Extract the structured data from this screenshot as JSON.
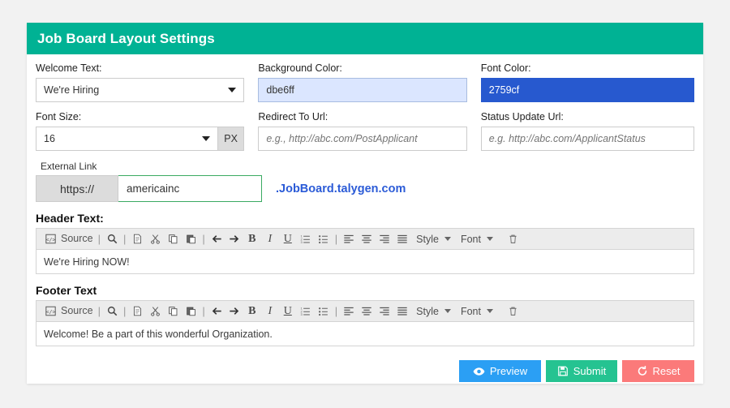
{
  "header": {
    "title": "Job Board Layout Settings",
    "bg_color": "#00b294"
  },
  "form": {
    "welcome_text": {
      "label": "Welcome Text:",
      "value": "We're Hiring"
    },
    "background_color": {
      "label": "Background Color:",
      "value": "dbe6ff",
      "swatch": "#dbe6ff"
    },
    "font_color": {
      "label": "Font Color:",
      "value": "2759cf",
      "swatch": "#2759cf"
    },
    "font_size": {
      "label": "Font Size:",
      "value": "16",
      "unit": "PX"
    },
    "redirect_url": {
      "label": "Redirect To Url:",
      "placeholder": "e.g., http://abc.com/PostApplicant",
      "value": ""
    },
    "status_update_url": {
      "label": "Status Update Url:",
      "placeholder": "e.g. http://abc.com/ApplicantStatus",
      "value": ""
    },
    "external_link": {
      "label": "External Link",
      "prefix": "https://",
      "value": "americainc",
      "suffix": ".JobBoard.talygen.com",
      "suffix_color": "#2b5bd7",
      "input_border_color": "#3aaa62"
    }
  },
  "header_text_editor": {
    "label": "Header Text:",
    "content": "We're Hiring NOW!"
  },
  "footer_text_editor": {
    "label": "Footer Text",
    "content": "Welcome! Be a part of this wonderful Organization."
  },
  "toolbar": {
    "source_label": "Source",
    "style_label": "Style",
    "font_label": "Font"
  },
  "actions": {
    "preview": "Preview",
    "submit": "Submit",
    "reset": "Reset",
    "preview_color": "#2b9ff4",
    "submit_color": "#25c391",
    "reset_color": "#fb7a7a"
  }
}
